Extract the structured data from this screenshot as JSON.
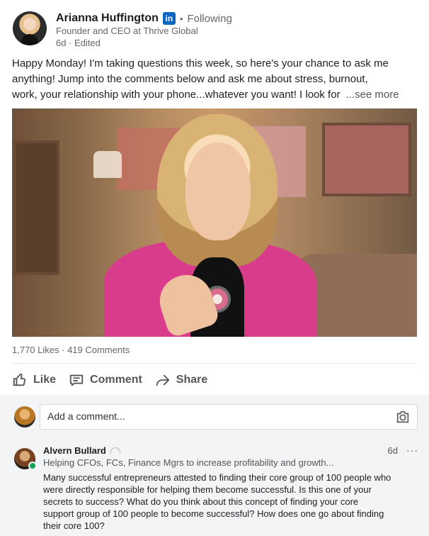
{
  "post": {
    "author": {
      "name": "Arianna Huffington",
      "badge": "in",
      "follow_status": "Following",
      "headline": "Founder and CEO at Thrive Global",
      "age": "6d",
      "edited": "Edited"
    },
    "text_lines": [
      "Happy Monday! I'm taking questions this week, so here's your chance to ask me",
      "anything! Jump into the comments below and ask me about stress, burnout,",
      "work, your relationship with your phone...whatever you want! I look for"
    ],
    "see_more": "...see more",
    "likes": "1,770 Likes",
    "comments_count": "419 Comments",
    "actions": {
      "like": "Like",
      "comment": "Comment",
      "share": "Share"
    }
  },
  "comment_box": {
    "placeholder": "Add a comment..."
  },
  "comment": {
    "name": "Alvern Bullard",
    "headline": "Helping CFOs, FCs, Finance Mgrs to increase profitability and growth...",
    "age": "6d",
    "more": "···",
    "body_lines": [
      "Many successful entrepreneurs attested to finding their core group of 100 people who",
      "were directly responsible for helping them become successful.  Is this one of your",
      "secrets to success?  What do you think about this concept of finding your core",
      "support group of 100 people to become successful?  How does one go about finding",
      "their core 100?"
    ]
  },
  "colors": {
    "linkedin_blue": "#0a66c2",
    "muted_text": "#666666",
    "comment_background": "#f3f4f6"
  }
}
